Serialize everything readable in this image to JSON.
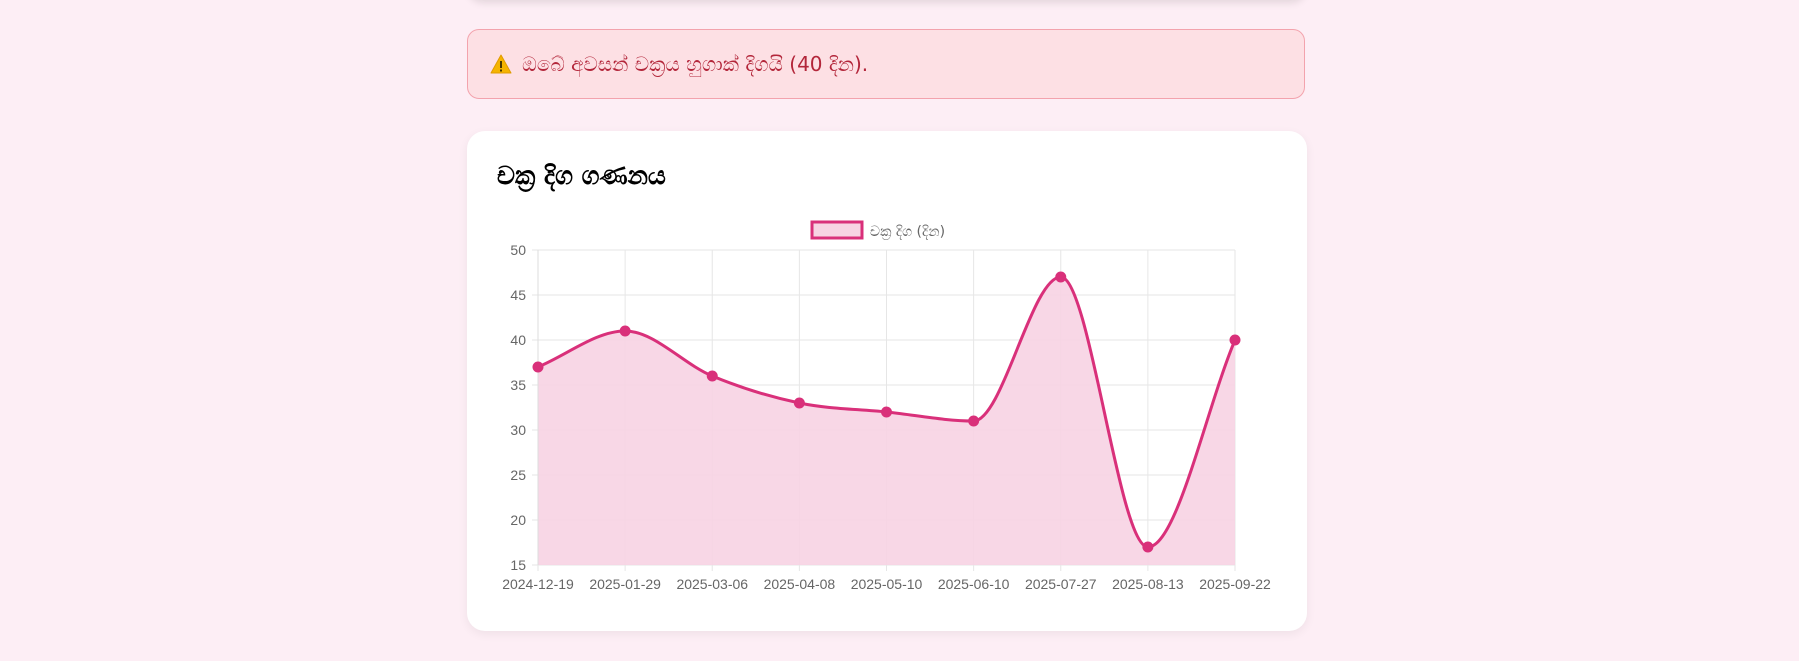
{
  "alert": {
    "icon": "warning-icon",
    "text": "ඔබේ අවසන් චක්‍රය හුගාක් දිගයි (40 දින)."
  },
  "chart": {
    "title": "චක්‍ර දිග ගණනය"
  },
  "colors": {
    "page_bg": "#fdeef5",
    "line": "#d9307a",
    "fill": "#f7d3e3",
    "alert_bg": "#fde0e4",
    "alert_border": "#f3a3ad",
    "alert_text": "#b3263a",
    "grid": "#e6e6e6",
    "tick_text": "#666666"
  },
  "chart_data": {
    "type": "line",
    "title": "චක්‍ර දිග ගණනය",
    "x": [
      "2024-12-19",
      "2025-01-29",
      "2025-03-06",
      "2025-04-08",
      "2025-05-10",
      "2025-06-10",
      "2025-07-27",
      "2025-08-13",
      "2025-09-22"
    ],
    "series": [
      {
        "name": "චක්‍ර දිග (දින)",
        "values": [
          37,
          41,
          36,
          33,
          32,
          31,
          47,
          17,
          40
        ],
        "fill": true,
        "curve": "smooth",
        "color": "#d9307a"
      }
    ],
    "ylim": [
      15,
      50
    ],
    "yticks": [
      15,
      20,
      25,
      30,
      35,
      40,
      45,
      50
    ],
    "grid": true,
    "legend": "top-center",
    "xlabel": "",
    "ylabel": ""
  }
}
